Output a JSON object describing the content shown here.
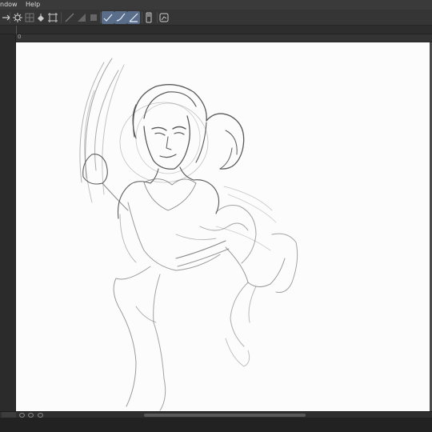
{
  "menu": {
    "window_label": "ndow",
    "help_label": "Help"
  },
  "toolbar": {
    "icons": [
      "arrow-icon",
      "gear-icon",
      "grid-icon",
      "fill-icon",
      "transform-icon",
      "brush-icon",
      "shape-icon",
      "square-icon",
      "ruler-icon",
      "ruler-curve-icon",
      "ruler-fix-icon",
      "phone-icon",
      "chart-icon"
    ]
  },
  "ruler": {
    "origin_label": "0"
  },
  "canvas": {
    "paper_color": "#fcfcfc",
    "stroke_color": "#555555"
  }
}
